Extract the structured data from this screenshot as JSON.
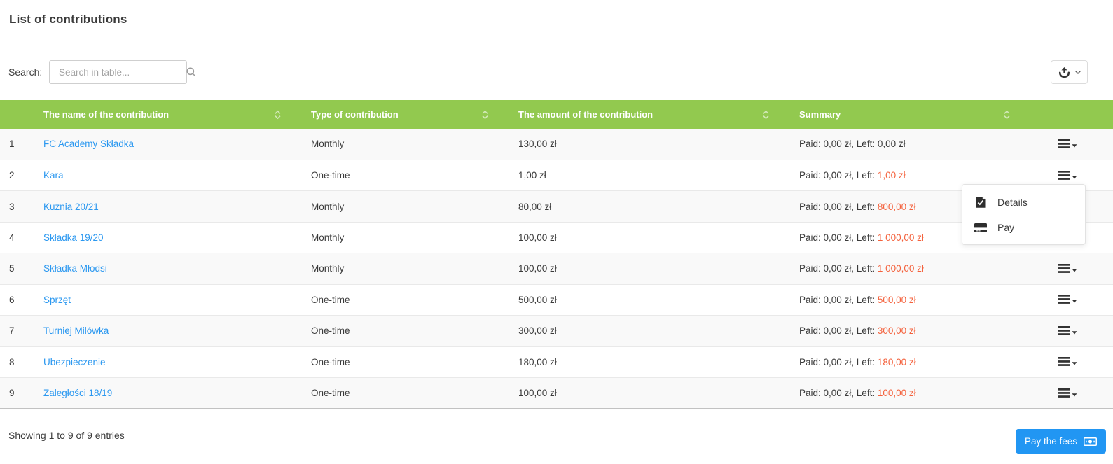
{
  "page": {
    "title": "List of contributions"
  },
  "search": {
    "label": "Search:",
    "placeholder": "Search in table..."
  },
  "table": {
    "headers": {
      "name": "The name of the contribution",
      "type": "Type of contribution",
      "amount": "The amount of the contribution",
      "summary": "Summary"
    },
    "rows": [
      {
        "no": "1",
        "name": "FC Academy Składka",
        "type": "Monthly",
        "amount": "130,00 zł",
        "summary_prefix": "Paid: 0,00 zł, Left: ",
        "summary_left": "0,00 zł",
        "left_class": "plain"
      },
      {
        "no": "2",
        "name": "Kara",
        "type": "One-time",
        "amount": "1,00 zł",
        "summary_prefix": "Paid: 0,00 zł, Left: ",
        "summary_left": "1,00 zł",
        "left_class": "due"
      },
      {
        "no": "3",
        "name": "Kuznia 20/21",
        "type": "Monthly",
        "amount": "80,00 zł",
        "summary_prefix": "Paid: 0,00 zł, Left: ",
        "summary_left": "800,00 zł",
        "left_class": "due"
      },
      {
        "no": "4",
        "name": "Składka 19/20",
        "type": "Monthly",
        "amount": "100,00 zł",
        "summary_prefix": "Paid: 0,00 zł, Left: ",
        "summary_left": "1 000,00 zł",
        "left_class": "due"
      },
      {
        "no": "5",
        "name": "Składka Młodsi",
        "type": "Monthly",
        "amount": "100,00 zł",
        "summary_prefix": "Paid: 0,00 zł, Left: ",
        "summary_left": "1 000,00 zł",
        "left_class": "due"
      },
      {
        "no": "6",
        "name": "Sprzęt",
        "type": "One-time",
        "amount": "500,00 zł",
        "summary_prefix": "Paid: 0,00 zł, Left: ",
        "summary_left": "500,00 zł",
        "left_class": "due"
      },
      {
        "no": "7",
        "name": "Turniej Milówka",
        "type": "One-time",
        "amount": "300,00 zł",
        "summary_prefix": "Paid: 0,00 zł, Left: ",
        "summary_left": "300,00 zł",
        "left_class": "due"
      },
      {
        "no": "8",
        "name": "Ubezpieczenie",
        "type": "One-time",
        "amount": "180,00 zł",
        "summary_prefix": "Paid: 0,00 zł, Left: ",
        "summary_left": "180,00 zł",
        "left_class": "due"
      },
      {
        "no": "9",
        "name": "Zaległości 18/19",
        "type": "One-time",
        "amount": "100,00 zł",
        "summary_prefix": "Paid: 0,00 zł, Left: ",
        "summary_left": "100,00 zł",
        "left_class": "due"
      }
    ]
  },
  "menu": {
    "details": "Details",
    "pay": "Pay"
  },
  "footer": {
    "showing": "Showing 1 to 9 of 9 entries",
    "pay_button": "Pay the fees"
  },
  "icons": {
    "export": "export-icon",
    "chevron": "chevron-down-icon",
    "search": "search-icon",
    "sort": "sort-icon",
    "row_actions": "hamburger-caret-icon",
    "details": "document-check-icon",
    "pay": "credit-card-icon",
    "banknote": "banknote-icon"
  },
  "colors": {
    "header_green": "#92c94f",
    "link_blue": "#2b98f0",
    "overdue_red": "#f4613c",
    "button_blue": "#2196f3"
  }
}
